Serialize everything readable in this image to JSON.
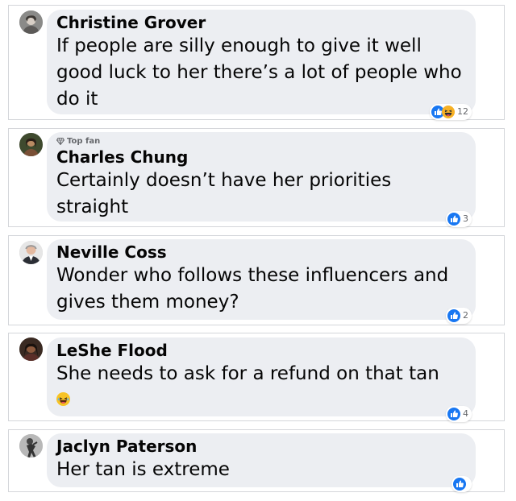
{
  "comments": [
    {
      "author": "Christine Grover",
      "text": "If people are silly enough to give it well good luck to her there’s a lot of people who do it",
      "reaction_count": "12",
      "reactions": [
        "like-icon",
        "haha-icon"
      ]
    },
    {
      "badge": "Top fan",
      "badge_icon": "diamond-icon",
      "author": "Charles Chung",
      "text": "Certainly doesn’t have her priorities straight",
      "reaction_count": "3",
      "reactions": [
        "like-icon"
      ]
    },
    {
      "author": "Neville Coss",
      "text": "Wonder who follows these influencers and gives them money?",
      "reaction_count": "2",
      "reactions": [
        "like-icon"
      ]
    },
    {
      "author": "LeShe Flood",
      "text": "She needs to ask for a refund on that tan",
      "emoji": "laughing-emoji-icon",
      "reaction_count": "4",
      "reactions": [
        "like-icon"
      ]
    },
    {
      "author": "Jaclyn Paterson",
      "text": "Her tan is extreme",
      "reaction_count": "",
      "reactions": [
        "like-icon"
      ]
    }
  ],
  "colors": {
    "like_blue": "#1877f2",
    "bubble_bg": "#eceef2",
    "text": "#050505",
    "meta": "#65676b"
  }
}
